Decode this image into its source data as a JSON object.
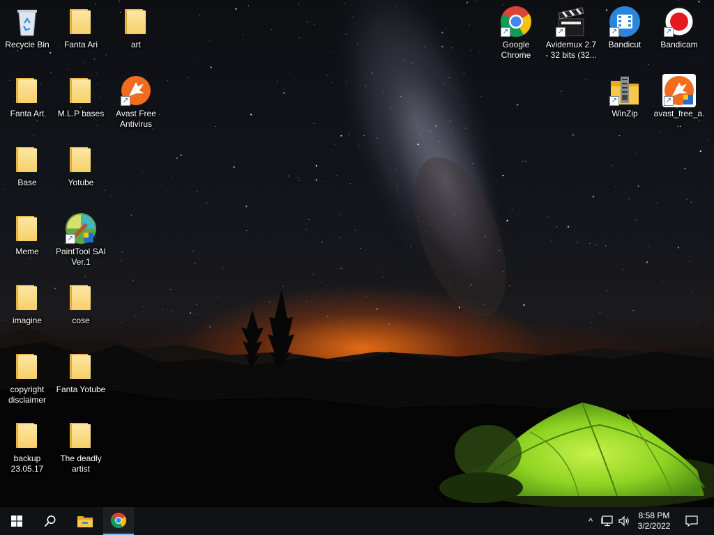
{
  "desktop": {
    "icons_left": [
      {
        "label": "Recycle Bin",
        "type": "recycle-bin"
      },
      {
        "label": "Fanta Ari",
        "type": "folder"
      },
      {
        "label": "art",
        "type": "folder"
      },
      {
        "label": "Fanta Art",
        "type": "folder"
      },
      {
        "label": "M.L.P bases",
        "type": "folder"
      },
      {
        "label": "Avast Free Antivirus",
        "type": "avast"
      },
      {
        "label": "Base",
        "type": "folder"
      },
      {
        "label": "Yotube",
        "type": "folder"
      },
      {
        "label": "Meme",
        "type": "folder"
      },
      {
        "label": "PaintTool SAI Ver.1",
        "type": "painttool-sai"
      },
      {
        "label": "imagine",
        "type": "folder"
      },
      {
        "label": "cose",
        "type": "folder"
      },
      {
        "label": "copyright disclaimer",
        "type": "folder"
      },
      {
        "label": "Fanta Yotube",
        "type": "folder"
      },
      {
        "label": "backup 23.05.17",
        "type": "folder"
      },
      {
        "label": "The deadly artist",
        "type": "folder"
      }
    ],
    "icons_right": [
      {
        "label": "Google Chrome",
        "type": "chrome"
      },
      {
        "label": "Avidemux 2.7 - 32 bits (32...",
        "type": "avidemux"
      },
      {
        "label": "Bandicut",
        "type": "bandicut"
      },
      {
        "label": "Bandicam",
        "type": "bandicam"
      },
      {
        "label": "WinZip",
        "type": "winzip"
      },
      {
        "label": "avast_free_a...",
        "type": "avast-installer"
      }
    ]
  },
  "taskbar": {
    "start_icon": "windows-logo-icon",
    "search_icon": "search-icon",
    "pinned": [
      {
        "name": "file-explorer",
        "icon": "folder-icon"
      },
      {
        "name": "google-chrome",
        "icon": "chrome-icon",
        "active": true
      }
    ],
    "tray": {
      "chevron": "^",
      "time": "8:58 PM",
      "date": "3/2/2022",
      "network_icon": "network-icon",
      "volume_icon": "volume-icon",
      "notifications_icon": "action-center-icon"
    }
  },
  "colors": {
    "taskbar": "#101216",
    "accent": "#76b9ed",
    "folder": "#f6cf6a",
    "tent": "#9be02c",
    "horizon_glow": "#ff7a1a"
  }
}
